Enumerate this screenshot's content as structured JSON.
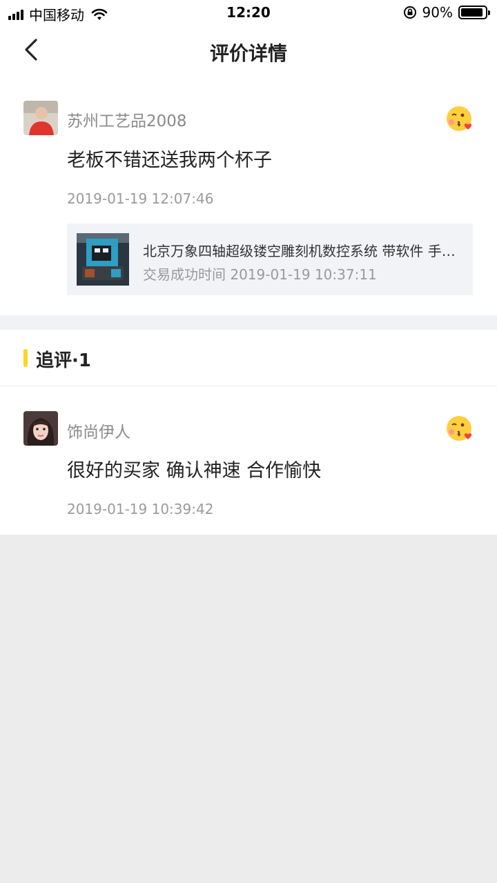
{
  "status_bar": {
    "carrier": "中国移动",
    "time": "12:20",
    "battery_percent": "90%",
    "battery_level": 0.9
  },
  "nav": {
    "title": "评价详情",
    "back_icon": "chevron-left-icon"
  },
  "review": {
    "username": "苏州工艺品2008",
    "content": "老板不错还送我两个杯子",
    "timestamp": "2019-01-19 12:07:46",
    "emoji_icon": "kiss-face-icon",
    "product": {
      "title": "北京万象四轴超级镂空雕刻机数控系统 带软件 手…",
      "trade_time": "交易成功时间 2019-01-19 10:37:11"
    }
  },
  "followup": {
    "header": "追评·1",
    "accent_color": "#ffd426",
    "items": [
      {
        "username": "饰尚伊人",
        "content": "很好的买家 确认神速 合作愉快",
        "timestamp": "2019-01-19 10:39:42",
        "emoji_icon": "kiss-face-icon"
      }
    ]
  }
}
